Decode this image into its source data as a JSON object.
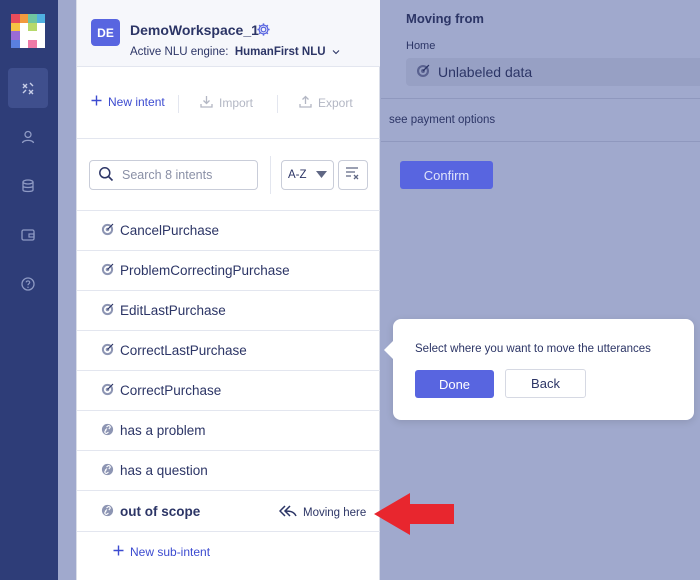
{
  "workspace": {
    "avatar": "DE",
    "name": "DemoWorkspace_1",
    "engine_label": "Active NLU engine:",
    "engine_value": "HumanFirst NLU"
  },
  "toolbar": {
    "new_intent": "New intent",
    "import": "Import",
    "export": "Export"
  },
  "search": {
    "placeholder": "Search 8 intents",
    "sort_value": "A-Z"
  },
  "intents": [
    {
      "label": "CancelPurchase",
      "icon": "target-icon"
    },
    {
      "label": "ProblemCorrectingPurchase",
      "icon": "target-icon"
    },
    {
      "label": "EditLastPurchase",
      "icon": "target-icon"
    },
    {
      "label": "CorrectLastPurchase",
      "icon": "target-icon"
    },
    {
      "label": "CorrectPurchase",
      "icon": "target-icon"
    },
    {
      "label": "has a problem",
      "icon": "link-icon"
    },
    {
      "label": "has a question",
      "icon": "link-icon"
    },
    {
      "label": "out of scope",
      "icon": "link-icon"
    }
  ],
  "moving_here": "Moving here",
  "new_sub_intent": "New sub-intent",
  "move_panel": {
    "title": "Moving from",
    "breadcrumb": "Home",
    "source": "Unlabeled data",
    "payment_text": "see payment options",
    "confirm": "Confirm"
  },
  "popover": {
    "text": "Select where you want to move the utterances",
    "done": "Done",
    "back": "Back"
  },
  "colors": {
    "rail": "#2e3d78",
    "accent": "#5865e0",
    "overlay": "#a0a9cd",
    "arrow": "#e8262e"
  }
}
